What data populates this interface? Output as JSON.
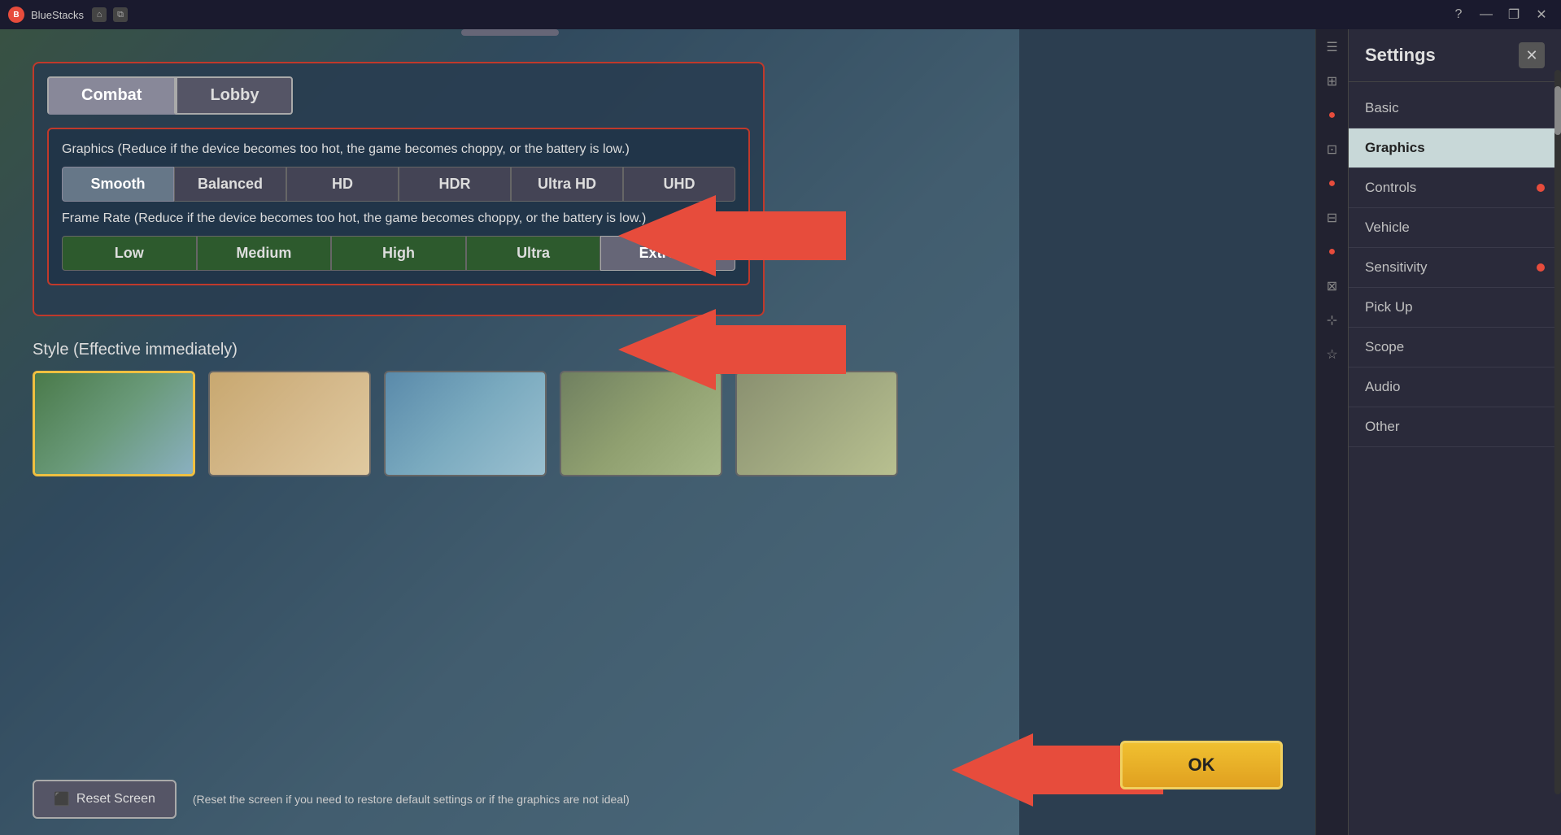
{
  "titlebar": {
    "app_name": "BlueStacks",
    "home_icon": "⌂",
    "multi_icon": "⧉",
    "help_icon": "?",
    "minimize_icon": "—",
    "restore_icon": "❐",
    "close_icon": "✕"
  },
  "game": {
    "drag_hint": ""
  },
  "settings": {
    "title": "Settings",
    "close_icon": "✕",
    "menu_items": [
      {
        "label": "Basic",
        "has_dot": false,
        "active": false
      },
      {
        "label": "Graphics",
        "has_dot": false,
        "active": true
      },
      {
        "label": "Controls",
        "has_dot": true,
        "active": false
      },
      {
        "label": "Vehicle",
        "has_dot": false,
        "active": false
      },
      {
        "label": "Sensitivity",
        "has_dot": true,
        "active": false
      },
      {
        "label": "Pick Up",
        "has_dot": false,
        "active": false
      },
      {
        "label": "Scope",
        "has_dot": false,
        "active": false
      },
      {
        "label": "Audio",
        "has_dot": false,
        "active": false
      },
      {
        "label": "Other",
        "has_dot": false,
        "active": false
      }
    ]
  },
  "tabs": {
    "combat_label": "Combat",
    "lobby_label": "Lobby"
  },
  "graphics_quality": {
    "section_label": "Graphics (Reduce if the device becomes too hot, the game becomes choppy, or the battery is low.)",
    "options": [
      {
        "label": "Smooth",
        "active": true
      },
      {
        "label": "Balanced",
        "active": false
      },
      {
        "label": "HD",
        "active": false
      },
      {
        "label": "HDR",
        "active": false
      },
      {
        "label": "Ultra HD",
        "active": false
      },
      {
        "label": "UHD",
        "active": false
      }
    ]
  },
  "frame_rate": {
    "section_label": "Frame Rate (Reduce if the device becomes too hot, the game becomes choppy, or the battery is low.)",
    "options": [
      {
        "label": "Low",
        "active": false
      },
      {
        "label": "Medium",
        "active": false
      },
      {
        "label": "High",
        "active": false
      },
      {
        "label": "Ultra",
        "active": false
      },
      {
        "label": "Extreme",
        "active": true
      }
    ]
  },
  "style": {
    "section_label": "Style (Effective immediately)",
    "thumbnails": [
      {
        "id": 1,
        "selected": true
      },
      {
        "id": 2,
        "selected": false
      },
      {
        "id": 3,
        "selected": false
      },
      {
        "id": 4,
        "selected": false
      },
      {
        "id": 5,
        "selected": false
      }
    ]
  },
  "bottom": {
    "reset_icon": "⬛",
    "reset_label": "Reset Screen",
    "reset_note": "(Reset the screen if you need to restore default settings or if the graphics are not ideal)",
    "ok_label": "OK"
  }
}
